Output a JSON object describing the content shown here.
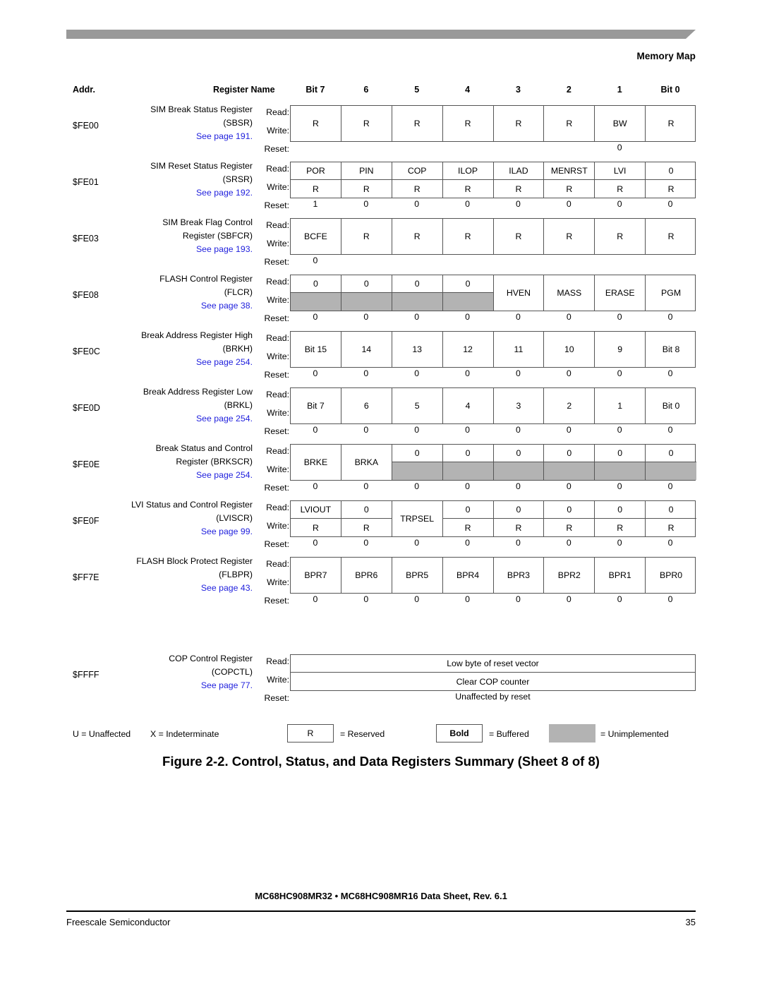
{
  "header": {
    "section_title": "Memory Map"
  },
  "table": {
    "headers": {
      "addr": "Addr.",
      "name": "Register Name",
      "bits": [
        "Bit 7",
        "6",
        "5",
        "4",
        "3",
        "2",
        "1",
        "Bit 0"
      ]
    },
    "labels": {
      "read": "Read:",
      "write": "Write:",
      "reset": "Reset:"
    },
    "registers": [
      {
        "addr": "$FE00",
        "name_line1": "SIM Break Status Register",
        "name_line2": "(SBSR)",
        "see_page": "See page 191.",
        "read": [
          "R",
          "R",
          "R",
          "R",
          "R",
          "R",
          "BW",
          "R"
        ],
        "write": [
          "R",
          "R",
          "R",
          "R",
          "R",
          "R",
          "BW",
          "R"
        ],
        "reset": [
          "",
          "",
          "",
          "",
          "",
          "",
          "0",
          ""
        ]
      },
      {
        "addr": "$FE01",
        "name_line1": "SIM Reset Status Register",
        "name_line2": "(SRSR)",
        "see_page": "See page 192.",
        "read": [
          "POR",
          "PIN",
          "COP",
          "ILOP",
          "ILAD",
          "MENRST",
          "LVI",
          "0"
        ],
        "write": [
          "R",
          "R",
          "R",
          "R",
          "R",
          "R",
          "R",
          "R"
        ],
        "reset": [
          "1",
          "0",
          "0",
          "0",
          "0",
          "0",
          "0",
          "0"
        ]
      },
      {
        "addr": "$FE03",
        "name_line1": "SIM Break Flag Control",
        "name_line2": "Register (SBFCR)",
        "see_page": "See page 193.",
        "read": [
          "BCFE",
          "R",
          "R",
          "R",
          "R",
          "R",
          "R",
          "R"
        ],
        "write": [
          "BCFE",
          "R",
          "R",
          "R",
          "R",
          "R",
          "R",
          "R"
        ],
        "reset": [
          "0",
          "",
          "",
          "",
          "",
          "",
          "",
          ""
        ]
      },
      {
        "addr": "$FE08",
        "name_line1": "FLASH Control Register",
        "name_line2": "(FLCR)",
        "see_page": "See page 38.",
        "read": [
          "0",
          "0",
          "0",
          "0",
          "HVEN",
          "MASS",
          "ERASE",
          "PGM"
        ],
        "write": [
          "",
          "",
          "",
          "",
          "HVEN",
          "MASS",
          "ERASE",
          "PGM"
        ],
        "reset": [
          "0",
          "0",
          "0",
          "0",
          "0",
          "0",
          "0",
          "0"
        ]
      },
      {
        "addr": "$FE0C",
        "name_line1": "Break Address Register High",
        "name_line2": "(BRKH)",
        "see_page": "See page 254.",
        "read": [
          "Bit 15",
          "14",
          "13",
          "12",
          "11",
          "10",
          "9",
          "Bit 8"
        ],
        "write": [
          "Bit 15",
          "14",
          "13",
          "12",
          "11",
          "10",
          "9",
          "Bit 8"
        ],
        "reset": [
          "0",
          "0",
          "0",
          "0",
          "0",
          "0",
          "0",
          "0"
        ]
      },
      {
        "addr": "$FE0D",
        "name_line1": "Break Address Register Low",
        "name_line2": "(BRKL)",
        "see_page": "See page 254.",
        "read": [
          "Bit 7",
          "6",
          "5",
          "4",
          "3",
          "2",
          "1",
          "Bit 0"
        ],
        "write": [
          "Bit 7",
          "6",
          "5",
          "4",
          "3",
          "2",
          "1",
          "Bit 0"
        ],
        "reset": [
          "0",
          "0",
          "0",
          "0",
          "0",
          "0",
          "0",
          "0"
        ]
      },
      {
        "addr": "$FE0E",
        "name_line1": "Break Status and Control",
        "name_line2": "Register (BRKSCR)",
        "see_page": "See page 254.",
        "read": [
          "BRKE",
          "BRKA",
          "0",
          "0",
          "0",
          "0",
          "0",
          "0"
        ],
        "write": [
          "BRKE",
          "BRKA",
          "",
          "",
          "",
          "",
          "",
          ""
        ],
        "reset": [
          "0",
          "0",
          "0",
          "0",
          "0",
          "0",
          "0",
          "0"
        ]
      },
      {
        "addr": "$FE0F",
        "name_line1": "LVI Status and Control Register",
        "name_line2": "(LVISCR)",
        "see_page": "See page 99.",
        "read": [
          "LVIOUT",
          "0",
          "TRPSEL",
          "0",
          "0",
          "0",
          "0",
          "0"
        ],
        "write": [
          "R",
          "R",
          "TRPSEL",
          "R",
          "R",
          "R",
          "R",
          "R"
        ],
        "reset": [
          "0",
          "0",
          "0",
          "0",
          "0",
          "0",
          "0",
          "0"
        ]
      },
      {
        "addr": "$FF7E",
        "name_line1": "FLASH Block Protect Register",
        "name_line2": "(FLBPR)",
        "see_page": "See page 43.",
        "read": [
          "BPR7",
          "BPR6",
          "BPR5",
          "BPR4",
          "BPR3",
          "BPR2",
          "BPR1",
          "BPR0"
        ],
        "write": [
          "BPR7",
          "BPR6",
          "BPR5",
          "BPR4",
          "BPR3",
          "BPR2",
          "BPR1",
          "BPR0"
        ],
        "reset": [
          "0",
          "0",
          "0",
          "0",
          "0",
          "0",
          "0",
          "0"
        ]
      },
      {
        "addr": "$FFFF",
        "name_line1": "COP Control Register",
        "name_line2": "(COPCTL)",
        "see_page": "See page 77.",
        "read_full": "Low byte of reset vector",
        "write_full": "Clear COP counter",
        "reset_full": "Unaffected by reset"
      }
    ]
  },
  "legend": {
    "unaffected": "U = Unaffected",
    "indeterminate": "X = Indeterminate",
    "reserved_box": "R",
    "reserved_text": "= Reserved",
    "buffered_box": "Bold",
    "buffered_text": "= Buffered",
    "unimplemented_text": "= Unimplemented"
  },
  "caption": "Figure 2-2. Control, Status, and Data Registers Summary  (Sheet 8 of 8)",
  "footer": {
    "title": "MC68HC908MR32 • MC68HC908MR16 Data Sheet, Rev. 6.1",
    "left": "Freescale Semiconductor",
    "page": "35"
  },
  "colors": {
    "banner_gray": "#999999",
    "unimplemented_gray": "#b3b3b3",
    "link_blue": "#2222dd"
  }
}
